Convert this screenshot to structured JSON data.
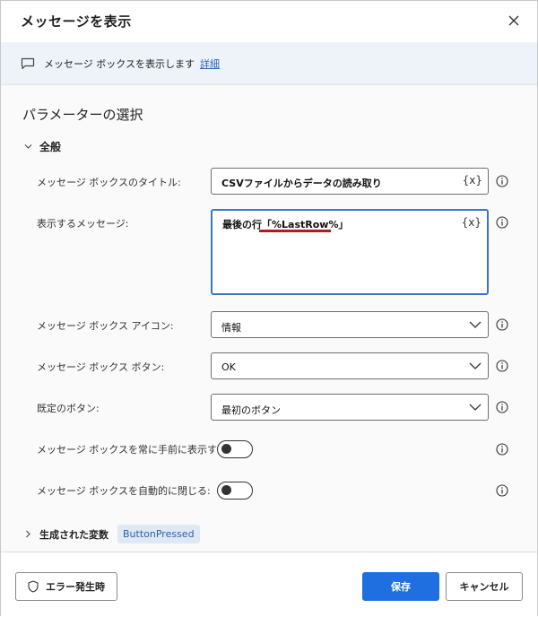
{
  "dialog": {
    "title": "メッセージを表示"
  },
  "info": {
    "text": "メッセージ ボックスを表示します",
    "link": "詳細"
  },
  "section": {
    "title": "パラメーターの選択"
  },
  "group": {
    "label": "全般"
  },
  "fields": {
    "title": {
      "label": "メッセージ ボックスのタイトル:",
      "value": "CSVファイルからデータの読み取り",
      "var_button": "{x}"
    },
    "message": {
      "label": "表示するメッセージ:",
      "value": "最後の行「%LastRow%」",
      "var_button": "{x}"
    },
    "icon": {
      "label": "メッセージ ボックス アイコン:",
      "value": "情報"
    },
    "buttons": {
      "label": "メッセージ ボックス ボタン:",
      "value": "OK"
    },
    "default_button": {
      "label": "既定のボタン:",
      "value": "最初のボタン"
    },
    "always_on_top": {
      "label": "メッセージ ボックスを常に手前に表示する:",
      "on": false
    },
    "auto_close": {
      "label": "メッセージ ボックスを自動的に閉じる:",
      "on": false
    }
  },
  "generated": {
    "label": "生成された変数",
    "variable": "ButtonPressed"
  },
  "footer": {
    "error_label": "エラー発生時",
    "save_label": "保存",
    "cancel_label": "キャンセル"
  },
  "colors": {
    "accent": "#1f6fe0",
    "link": "#2c63b6",
    "focus_border": "#3c75c4",
    "highlight_underline": "#b41b21"
  }
}
